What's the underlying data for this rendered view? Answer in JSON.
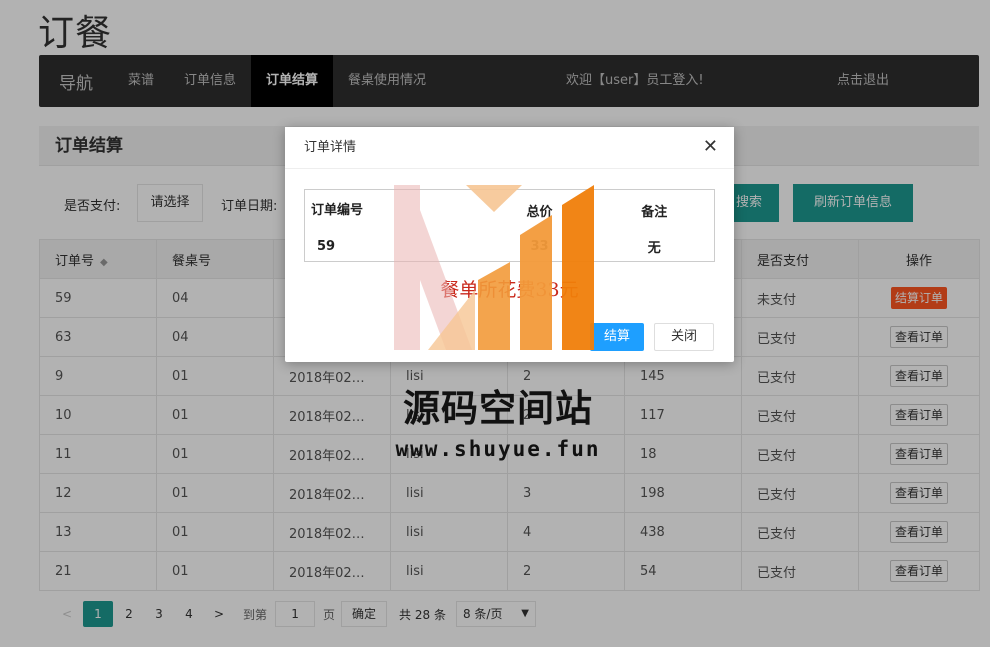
{
  "page_title": "订餐",
  "nav": {
    "brand": "导航",
    "items": [
      {
        "label": "菜谱",
        "active": false
      },
      {
        "label": "订单信息",
        "active": false
      },
      {
        "label": "订单结算",
        "active": true
      },
      {
        "label": "餐桌使用情况",
        "active": false
      }
    ],
    "welcome": "欢迎【user】员工登入!",
    "logout": "点击退出"
  },
  "panel": {
    "title": "订单结算",
    "filters": {
      "paid_label": "是否支付:",
      "paid_select": "请选择",
      "date_label": "订单日期:",
      "search_btn": "搜索",
      "refresh_btn": "刷新订单信息"
    },
    "columns": [
      "订单号",
      "餐桌号",
      "下单日期",
      "下单人",
      "人数",
      "总价",
      "是否支付",
      "操作"
    ],
    "rows": [
      {
        "id": "59",
        "table": "04",
        "date": "",
        "user": "",
        "people": "",
        "total": "",
        "paid": "未支付",
        "paid_flag": false,
        "action": "结算订单"
      },
      {
        "id": "63",
        "table": "04",
        "date": "",
        "user": "",
        "people": "",
        "total": "",
        "paid": "已支付",
        "paid_flag": true,
        "action": "查看订单"
      },
      {
        "id": "9",
        "table": "01",
        "date": "2018年02…",
        "user": "lisi",
        "people": "2",
        "total": "145",
        "paid": "已支付",
        "paid_flag": true,
        "action": "查看订单"
      },
      {
        "id": "10",
        "table": "01",
        "date": "2018年02…",
        "user": "lisi",
        "people": "2",
        "total": "117",
        "paid": "已支付",
        "paid_flag": true,
        "action": "查看订单"
      },
      {
        "id": "11",
        "table": "01",
        "date": "2018年02…",
        "user": "lisi",
        "people": "",
        "total": "18",
        "paid": "已支付",
        "paid_flag": true,
        "action": "查看订单"
      },
      {
        "id": "12",
        "table": "01",
        "date": "2018年02…",
        "user": "lisi",
        "people": "3",
        "total": "198",
        "paid": "已支付",
        "paid_flag": true,
        "action": "查看订单"
      },
      {
        "id": "13",
        "table": "01",
        "date": "2018年02…",
        "user": "lisi",
        "people": "4",
        "total": "438",
        "paid": "已支付",
        "paid_flag": true,
        "action": "查看订单"
      },
      {
        "id": "21",
        "table": "01",
        "date": "2018年02…",
        "user": "lisi",
        "people": "2",
        "total": "54",
        "paid": "已支付",
        "paid_flag": true,
        "action": "查看订单"
      }
    ],
    "pager": {
      "prev": "<",
      "pages": [
        "1",
        "2",
        "3",
        "4"
      ],
      "current": "1",
      "next": ">",
      "goto_label": "到第",
      "goto_value": "1",
      "page_unit": "页",
      "confirm": "确定",
      "total": "共 28 条",
      "page_size": "8 条/页"
    }
  },
  "dialog": {
    "title": "订单详情",
    "headers": [
      "订单编号",
      "",
      "总价",
      "备注"
    ],
    "values": [
      "59",
      "",
      "33",
      "无"
    ],
    "sum_text": "餐单所花费33元",
    "settle_btn": "结算",
    "close_btn": "关闭"
  },
  "watermark": {
    "text": "源码空间站",
    "url": "www.shuyue.fun",
    "colors": [
      "#f29a3a",
      "#f6c594",
      "#eab3b0"
    ]
  }
}
